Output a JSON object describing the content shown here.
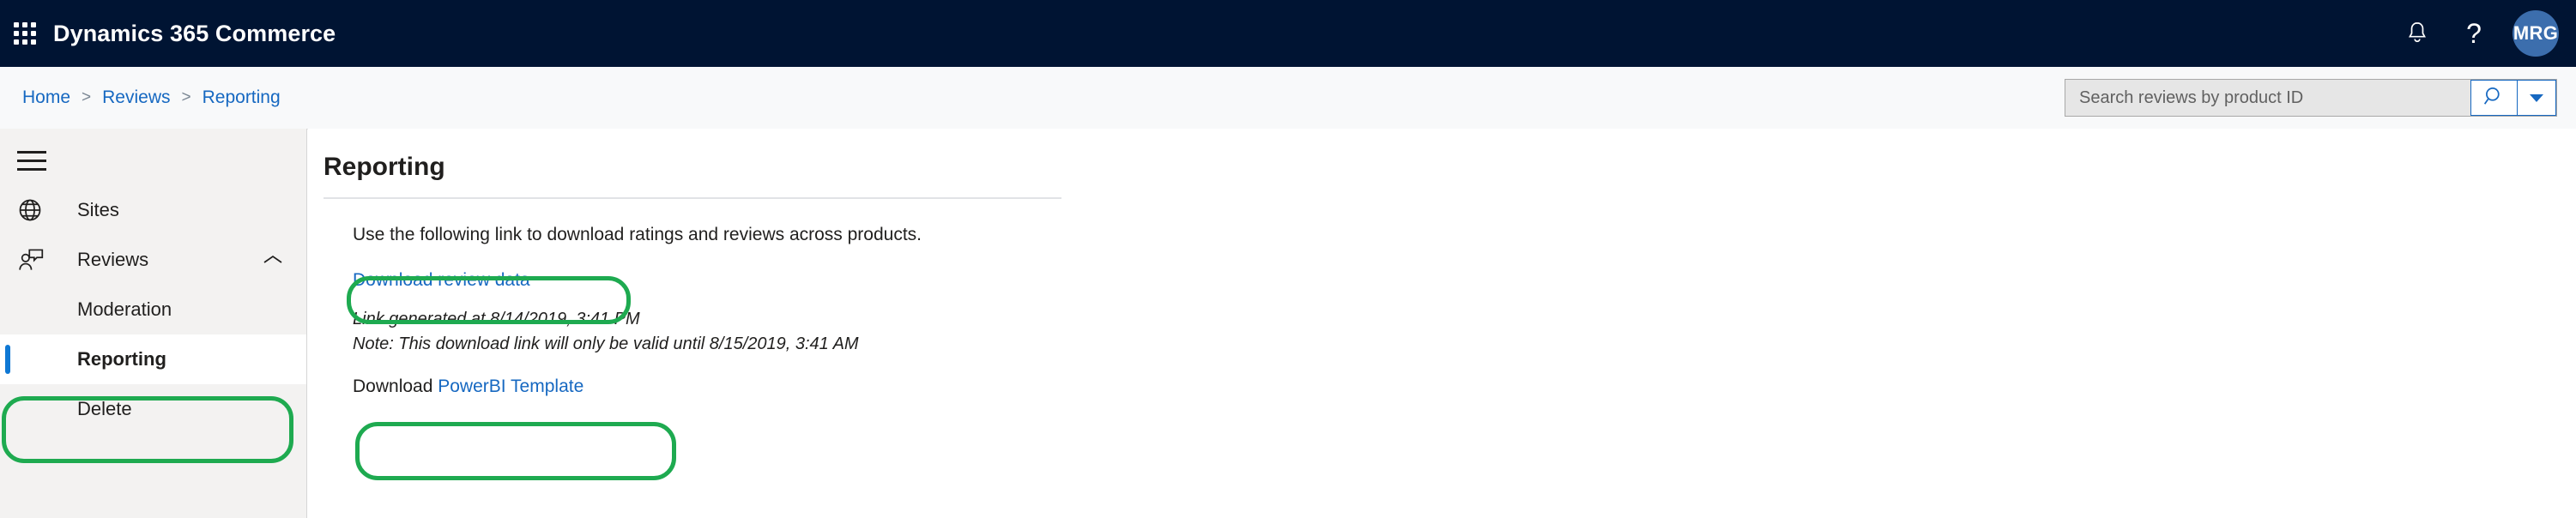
{
  "header": {
    "waffle_icon": "grid-waffle-icon",
    "app_title": "Dynamics 365 Commerce",
    "notifications_icon": "bell-icon",
    "help_icon": "question-mark-icon",
    "avatar_initials": "MRG",
    "background_color": "#001433"
  },
  "breadcrumb": {
    "items": [
      {
        "label": "Home"
      },
      {
        "label": "Reviews"
      },
      {
        "label": "Reporting"
      }
    ],
    "separator": ">",
    "link_color": "#1668c1"
  },
  "search": {
    "placeholder": "Search reviews by product ID",
    "value": "",
    "search_icon": "magnifier-icon",
    "caret_icon": "chevron-down-icon"
  },
  "sidebar": {
    "hamburger_icon": "hamburger-menu-icon",
    "items": [
      {
        "label": "Sites",
        "icon": "globe-icon",
        "level": "top",
        "selected": false
      },
      {
        "label": "Reviews",
        "icon": "person-review-icon",
        "level": "top",
        "selected": false,
        "expand_icon": "chevron-up-icon"
      },
      {
        "label": "Moderation",
        "icon": "",
        "level": "sub",
        "selected": false
      },
      {
        "label": "Reporting",
        "icon": "",
        "level": "sub",
        "selected": true
      },
      {
        "label": "Delete",
        "icon": "",
        "level": "sub",
        "selected": false
      }
    ],
    "background_color": "#f3f2f1",
    "selected_indicator_color": "#0f78d4"
  },
  "main": {
    "title": "Reporting",
    "intro": "Use the following link to download ratings and reviews across products.",
    "download_review_data_label": "Download review data",
    "note_generated": "Link generated at 8/14/2019, 3:41 PM",
    "note_validity": "Note: This download link will only be valid until 8/15/2019, 3:41 AM",
    "powerbi_prefix": "Download ",
    "powerbi_link_label": "PowerBI Template"
  },
  "annotations": {
    "color": "#1eaa50",
    "boxes": [
      {
        "name": "sidebar-reporting-highlight"
      },
      {
        "name": "download-review-data-highlight"
      },
      {
        "name": "powerbi-template-highlight"
      }
    ]
  }
}
